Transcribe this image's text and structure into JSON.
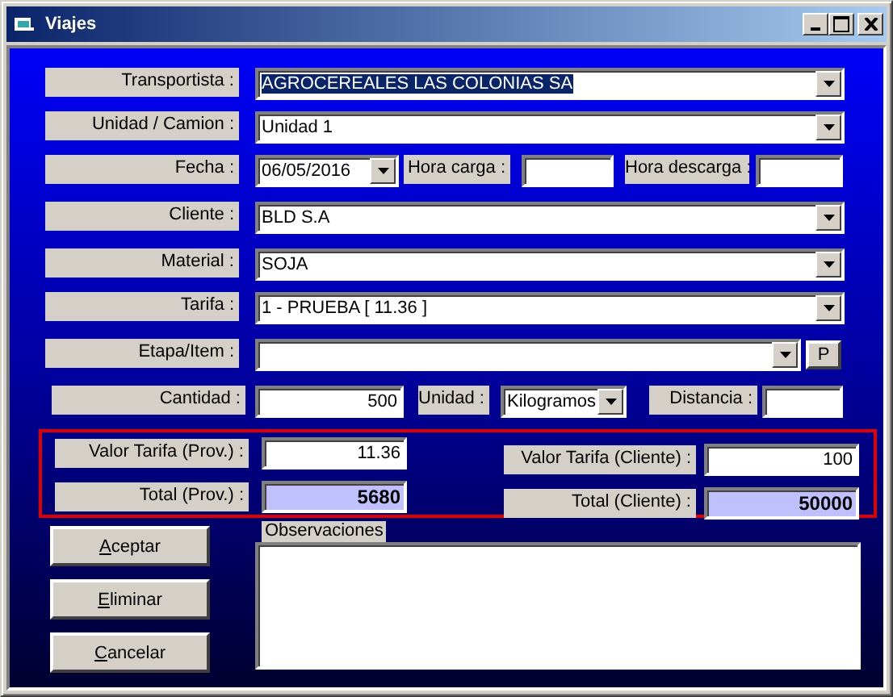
{
  "window": {
    "title": "Viajes"
  },
  "transportista": {
    "label": "Transportista :",
    "value": "AGROCEREALES LAS COLONIAS SA",
    "highlighted": true
  },
  "unidad_camion": {
    "label": "Unidad / Camion :",
    "value": "Unidad 1",
    "highlighted": false
  },
  "fecha": {
    "label": "Fecha :",
    "value": "06/05/2016"
  },
  "hora_carga": {
    "label": "Hora carga :"
  },
  "hora_descarga": {
    "label": "Hora descarga :"
  },
  "cliente": {
    "label": "Cliente :",
    "value": "BLD S.A",
    "highlighted": false
  },
  "material": {
    "label": "Material :",
    "value": "SOJA",
    "highlighted": false
  },
  "tarifa": {
    "label": "Tarifa :",
    "value": "1 - PRUEBA [ 11.36 ]",
    "highlighted": false
  },
  "etapa_item": {
    "label": "Etapa/Item :",
    "button": "P"
  },
  "cantidad": {
    "label": "Cantidad :",
    "value": "500"
  },
  "unidad": {
    "label": "Unidad :",
    "value": "Kilogramos"
  },
  "distancia": {
    "label": "Distancia :"
  },
  "valor_tarifa_prov": {
    "label": "Valor Tarifa (Prov.) :",
    "value": "11.36"
  },
  "total_prov": {
    "label": "Total (Prov.) :",
    "value": "5680"
  },
  "valor_tarifa_cliente": {
    "label": "Valor Tarifa (Cliente) :",
    "value": "100"
  },
  "total_cliente": {
    "label": "Total (Cliente) :",
    "value": "50000"
  },
  "observaciones": {
    "label": "Observaciones"
  },
  "buttons": [
    "Aceptar",
    "Eliminar",
    "Cancelar"
  ]
}
